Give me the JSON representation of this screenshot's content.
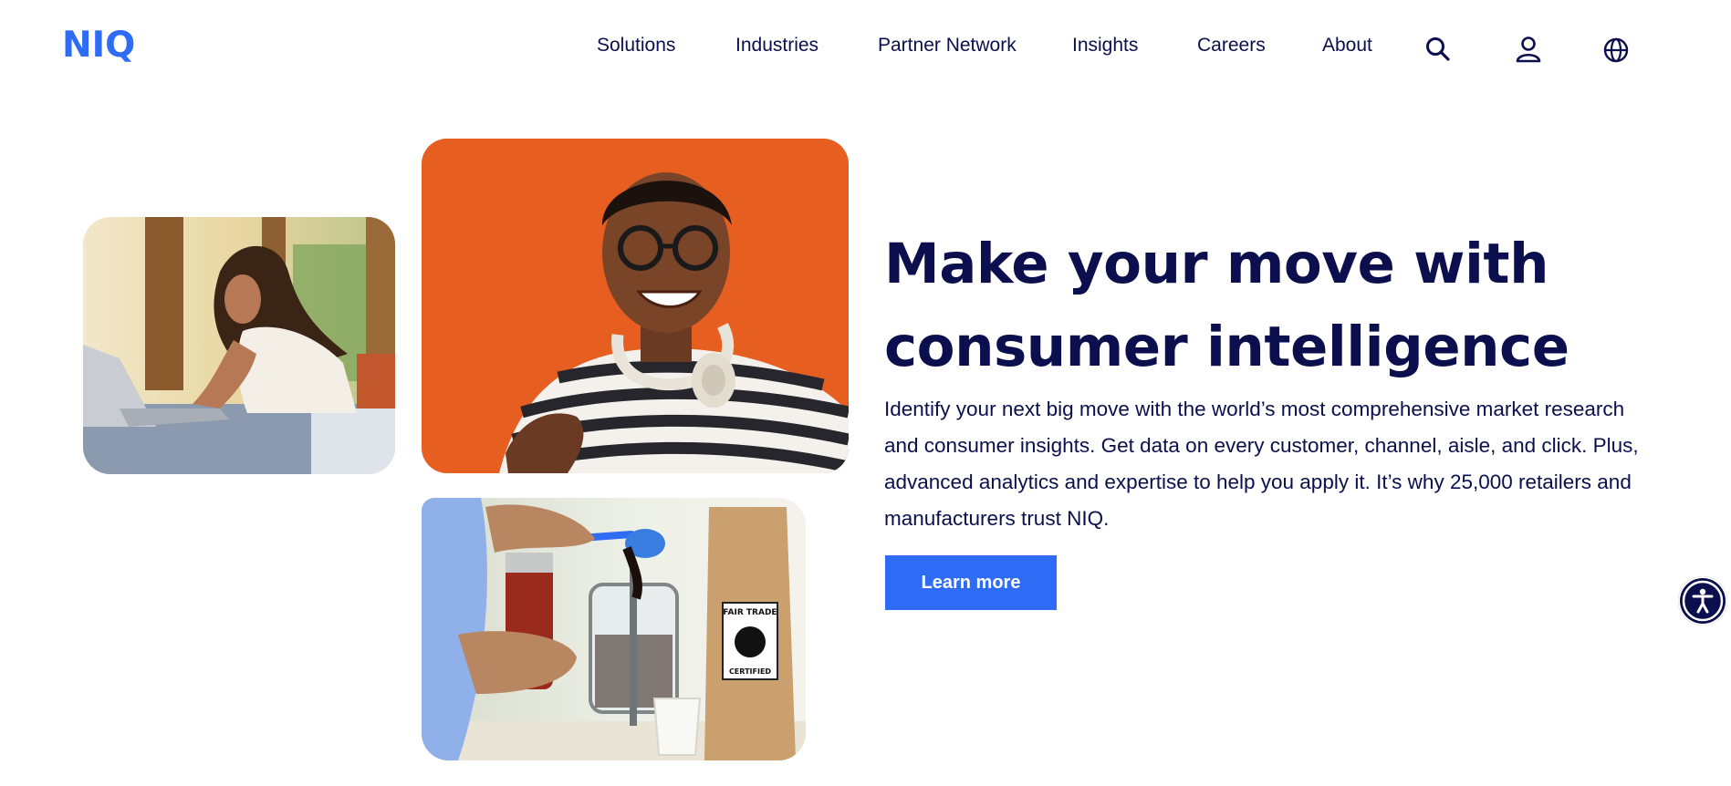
{
  "brand": {
    "logo_text": "NIQ",
    "accent_color": "#2f6cf6",
    "text_color": "#0b0f4d"
  },
  "nav": {
    "items": [
      {
        "label": "Solutions"
      },
      {
        "label": "Industries"
      },
      {
        "label": "Partner Network"
      },
      {
        "label": "Insights"
      },
      {
        "label": "Careers"
      },
      {
        "label": "About"
      }
    ],
    "icons": [
      "search-icon",
      "user-icon",
      "globe-icon"
    ]
  },
  "hero": {
    "title_line1": "Make your move with",
    "title_line2": "consumer intelligence",
    "body": "Identify your next big move with the world’s most comprehensive market research and consumer insights. Get data on every customer, channel, aisle, and click. Plus, advanced analytics and expertise to help you apply it. It’s why 25,000 retailers and manufacturers trust NIQ.",
    "cta_label": "Learn more"
  },
  "images": {
    "coffee_bag_label_top": "FAIR TRADE",
    "coffee_bag_label_bottom": "CERTIFIED"
  },
  "accessibility": {
    "icon": "accessibility-icon"
  }
}
